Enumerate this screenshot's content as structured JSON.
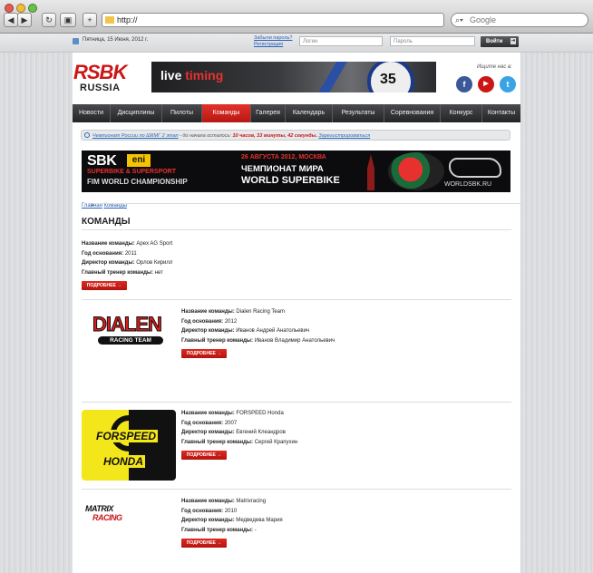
{
  "browser": {
    "url": "http://",
    "search_placeholder": "Google",
    "back_icon": "◀",
    "forward_icon": "▶",
    "reload_icon": "↻",
    "add_icon": "+"
  },
  "topbar": {
    "date": "Пятница, 15 Июня, 2012 г.",
    "forgot_password": "Забыли пароль?",
    "register": "Регистрация",
    "login_placeholder": "Логин",
    "password_placeholder": "Пароль",
    "login_button": "Войти"
  },
  "header": {
    "logo_top": "RSBK",
    "logo_bottom": "RUSSIA",
    "live_word1": "live",
    "live_word2": "timing",
    "bike_number": "35",
    "find_us": "Ищите нас в:",
    "social": [
      {
        "name": "facebook",
        "glyph": "f",
        "color": "#3b5998"
      },
      {
        "name": "youtube",
        "glyph": "▶",
        "color": "#cc1616"
      },
      {
        "name": "twitter",
        "glyph": "t",
        "color": "#3aa3e3"
      }
    ]
  },
  "menu": [
    "Новости",
    "Дисциплины",
    "Пилоты",
    "Команды",
    "Галерея",
    "Календарь",
    "Результаты",
    "Соревнования",
    "Конкурс",
    "Контакты"
  ],
  "ticker": {
    "link": "Чемпионат России по ШКМГ 2 этап",
    "text1": " - до начала осталось: ",
    "countdown": "10 часов, 33 минуты, 42 секунды.",
    "register_link": "Зарегистрироваться"
  },
  "banner": {
    "sbk": "SBK",
    "eni": "eni",
    "superbike": "SUPERBIKE & SUPERSPORT",
    "fim": "FIM WORLD CHAMPIONSHIP",
    "date": "26 АВГУСТА 2012, МОСКВА",
    "champ": "ЧЕМПИОНАТ МИРА",
    "world": "WORLD SUPERBIKE",
    "url": "WORLDSBK.RU"
  },
  "breadcrumb": {
    "home": "Главная",
    "sep": ">",
    "current": "Команды"
  },
  "page_title": "КОМАНДЫ",
  "labels": {
    "name": "Название команды:",
    "founded": "Год основания:",
    "director": "Директор команды:",
    "coach": "Главный тренер команды:",
    "more": "ПОДРОБНЕЕ →"
  },
  "teams": [
    {
      "name": "Apex AG Sport",
      "founded": "2011",
      "director": "Орлов Кирилл",
      "coach": "нет"
    },
    {
      "name": "Dialen Racing Team",
      "founded": "2012",
      "director": "Иванов Андрей Анатольевич",
      "coach": "Иванов Владимир Анатольевич"
    },
    {
      "name": "FORSPEED Honda",
      "founded": "2007",
      "director": "Евгений Клеандров",
      "coach": "Сергей Крапухин"
    },
    {
      "name": "Matrixracing",
      "founded": "2010",
      "director": "Медведева Мария",
      "coach": "-"
    }
  ],
  "logos": {
    "dialen": "DIALEN",
    "dialen_sub": "RACING TEAM",
    "forspeed": "FORSPEED",
    "honda": "HONDA",
    "matrix1": "MATRIX",
    "matrix2": "RACING"
  }
}
